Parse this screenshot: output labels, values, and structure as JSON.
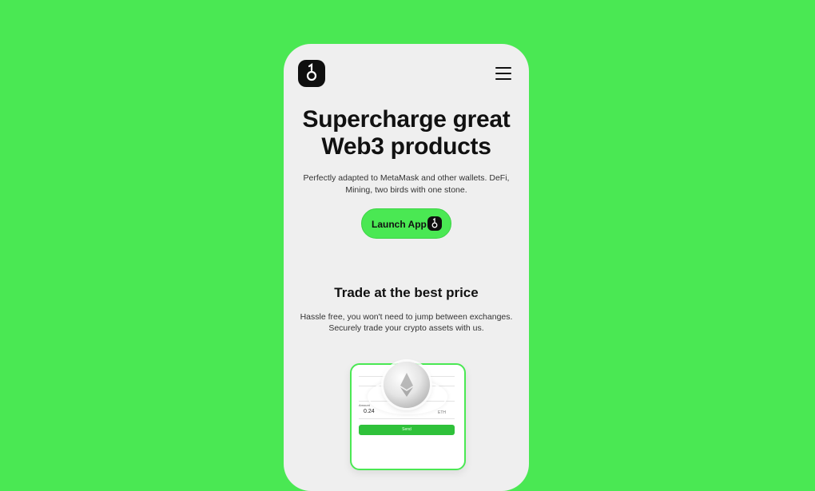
{
  "header": {
    "logo_icon": "brand-logo-icon",
    "menu_icon": "hamburger-menu-icon"
  },
  "hero": {
    "title_line1": "Supercharge great",
    "title_line2": "Web3 products",
    "subtitle_line1": "Perfectly adapted to MetaMask and other wallets. DeFi,",
    "subtitle_line2": "Mining, two birds with one stone.",
    "cta_label": "Launch App",
    "cta_icon": "brand-logo-icon"
  },
  "trade": {
    "title": "Trade at the best price",
    "subtitle_line1": "Hassle free, you won't need to jump between exchanges.",
    "subtitle_line2": "Securely trade your crypto assets with us."
  },
  "mockup": {
    "send_label": "Send",
    "amount_label": "Amount",
    "amount_value": "0.24",
    "amount_unit": "ETH",
    "coin_icon": "ethereum-icon"
  },
  "colors": {
    "background": "#4ae853",
    "accent": "#4ae853",
    "phone_bg": "#efefef",
    "text": "#111111"
  }
}
